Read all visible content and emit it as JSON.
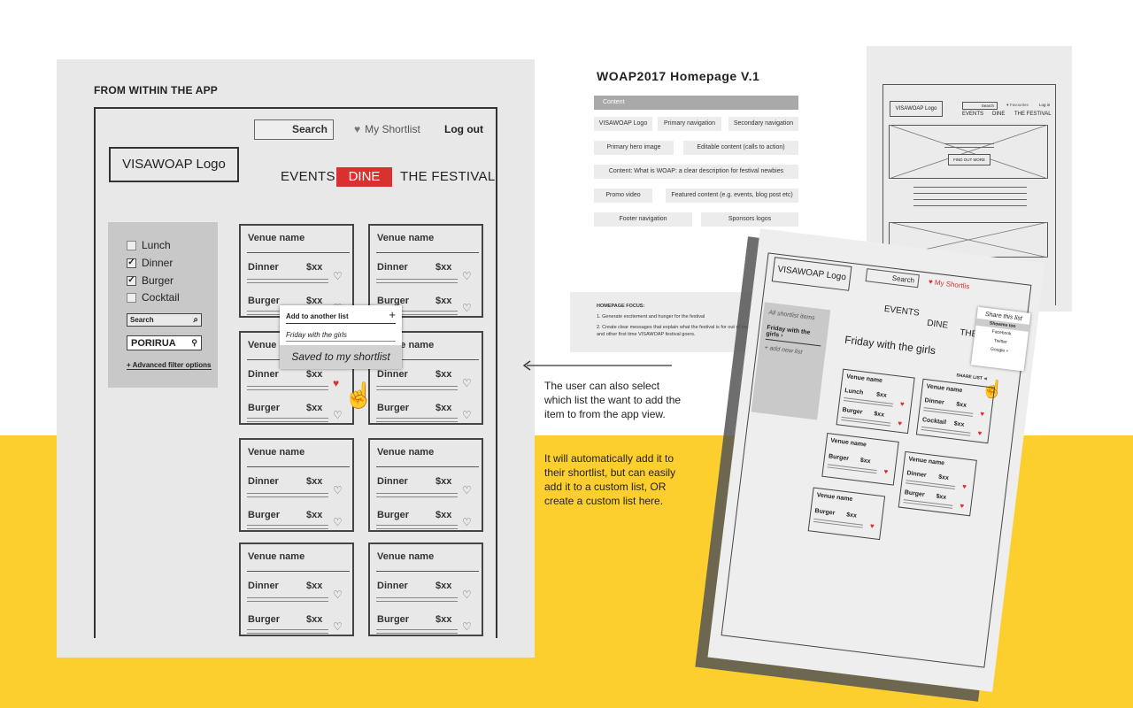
{
  "main": {
    "title": "FROM WITHIN THE APP",
    "search_label": "Search",
    "shortlist_label": "My Shortlist",
    "logout_label": "Log out",
    "logo": "VISAWOAP Logo",
    "nav": {
      "events": "EVENTS",
      "dine": "DINE",
      "festival": "THE FESTIVAL"
    },
    "filters": [
      {
        "label": "Lunch",
        "checked": false,
        "mark": ""
      },
      {
        "label": "Dinner",
        "checked": true,
        "mark": "✓"
      },
      {
        "label": "Burger",
        "checked": true,
        "mark": "✓"
      },
      {
        "label": "Cocktail",
        "checked": false,
        "mark": ""
      }
    ],
    "filter_search": "Search",
    "location": "PORIRUA",
    "advanced": "+ Advanced filter options",
    "card": {
      "venue": "Venue name",
      "dinner": "Dinner",
      "burger": "Burger",
      "price": "$xx"
    },
    "popup": {
      "add_list": "Add to another list",
      "plus": "+",
      "friday": "Friday with the girls",
      "saved": "Saved to my shortlist"
    }
  },
  "content_spec": {
    "title": "WOAP2017  Homepage  V.1",
    "header": "Content",
    "items": {
      "logo": "VISAWOAP Logo",
      "primary_nav": "Primary navigation",
      "secondary_nav": "Secondary navigation",
      "hero": "Primary hero image",
      "editable": "Editable content (calls to action)",
      "what_is": "Content: What is WOAP: a clear description for festival newbies",
      "promo": "Promo video",
      "featured": "Featured content (e.g. events, blog post etc)",
      "footer": "Footer navigation",
      "sponsors": "Sponsors logos"
    },
    "focus": {
      "title": "HOMEPAGE FOCUS:",
      "p1": "1. Generate excitement and hunger for the festival",
      "p2": "2. Create clear messages that explain what the festival is for out of towners and other first time VISAWOAP festival goers."
    }
  },
  "notes": {
    "n1": "The user can also  select which list the want to add the item to from the app view.",
    "n2": "It will automatically add it to their shortlist, but can easily add it to a custom list, OR create a custom list here."
  },
  "homepage_wireframe": {
    "logo": "VISAWOAP Logo",
    "search": "Search",
    "favourites": "♥ Favourites",
    "login": "Log in",
    "nav": {
      "events": "EVENTS",
      "dine": "DINE",
      "festival": "THE FESTIVAL"
    },
    "cta": "FIND OUT MORE"
  },
  "mobile": {
    "logo": "VISAWOAP Logo",
    "search": "Search",
    "shortlist": "♥ My Shortlis",
    "nav": {
      "events": "EVENTS",
      "dine": "DINE",
      "festival": "THE"
    },
    "side": {
      "all": "All shortlist items",
      "friday": "Friday with the girls  ›",
      "add": "+ add new list"
    },
    "list_title": "Friday with the girls",
    "share_label": "SHARE LIST",
    "share": {
      "title": "Share this list",
      "showme": "Showme too",
      "facebook": "Facebook",
      "twitter": "Twitter",
      "google": "Google +"
    },
    "cards": {
      "venue": "Venue name",
      "lunch": "Lunch",
      "burger": "Burger",
      "dinner": "Dinner",
      "cocktail": "Cocktail",
      "price": "$xx"
    }
  },
  "colors": {
    "accent": "#d93030",
    "yellow": "#fccf2e"
  }
}
